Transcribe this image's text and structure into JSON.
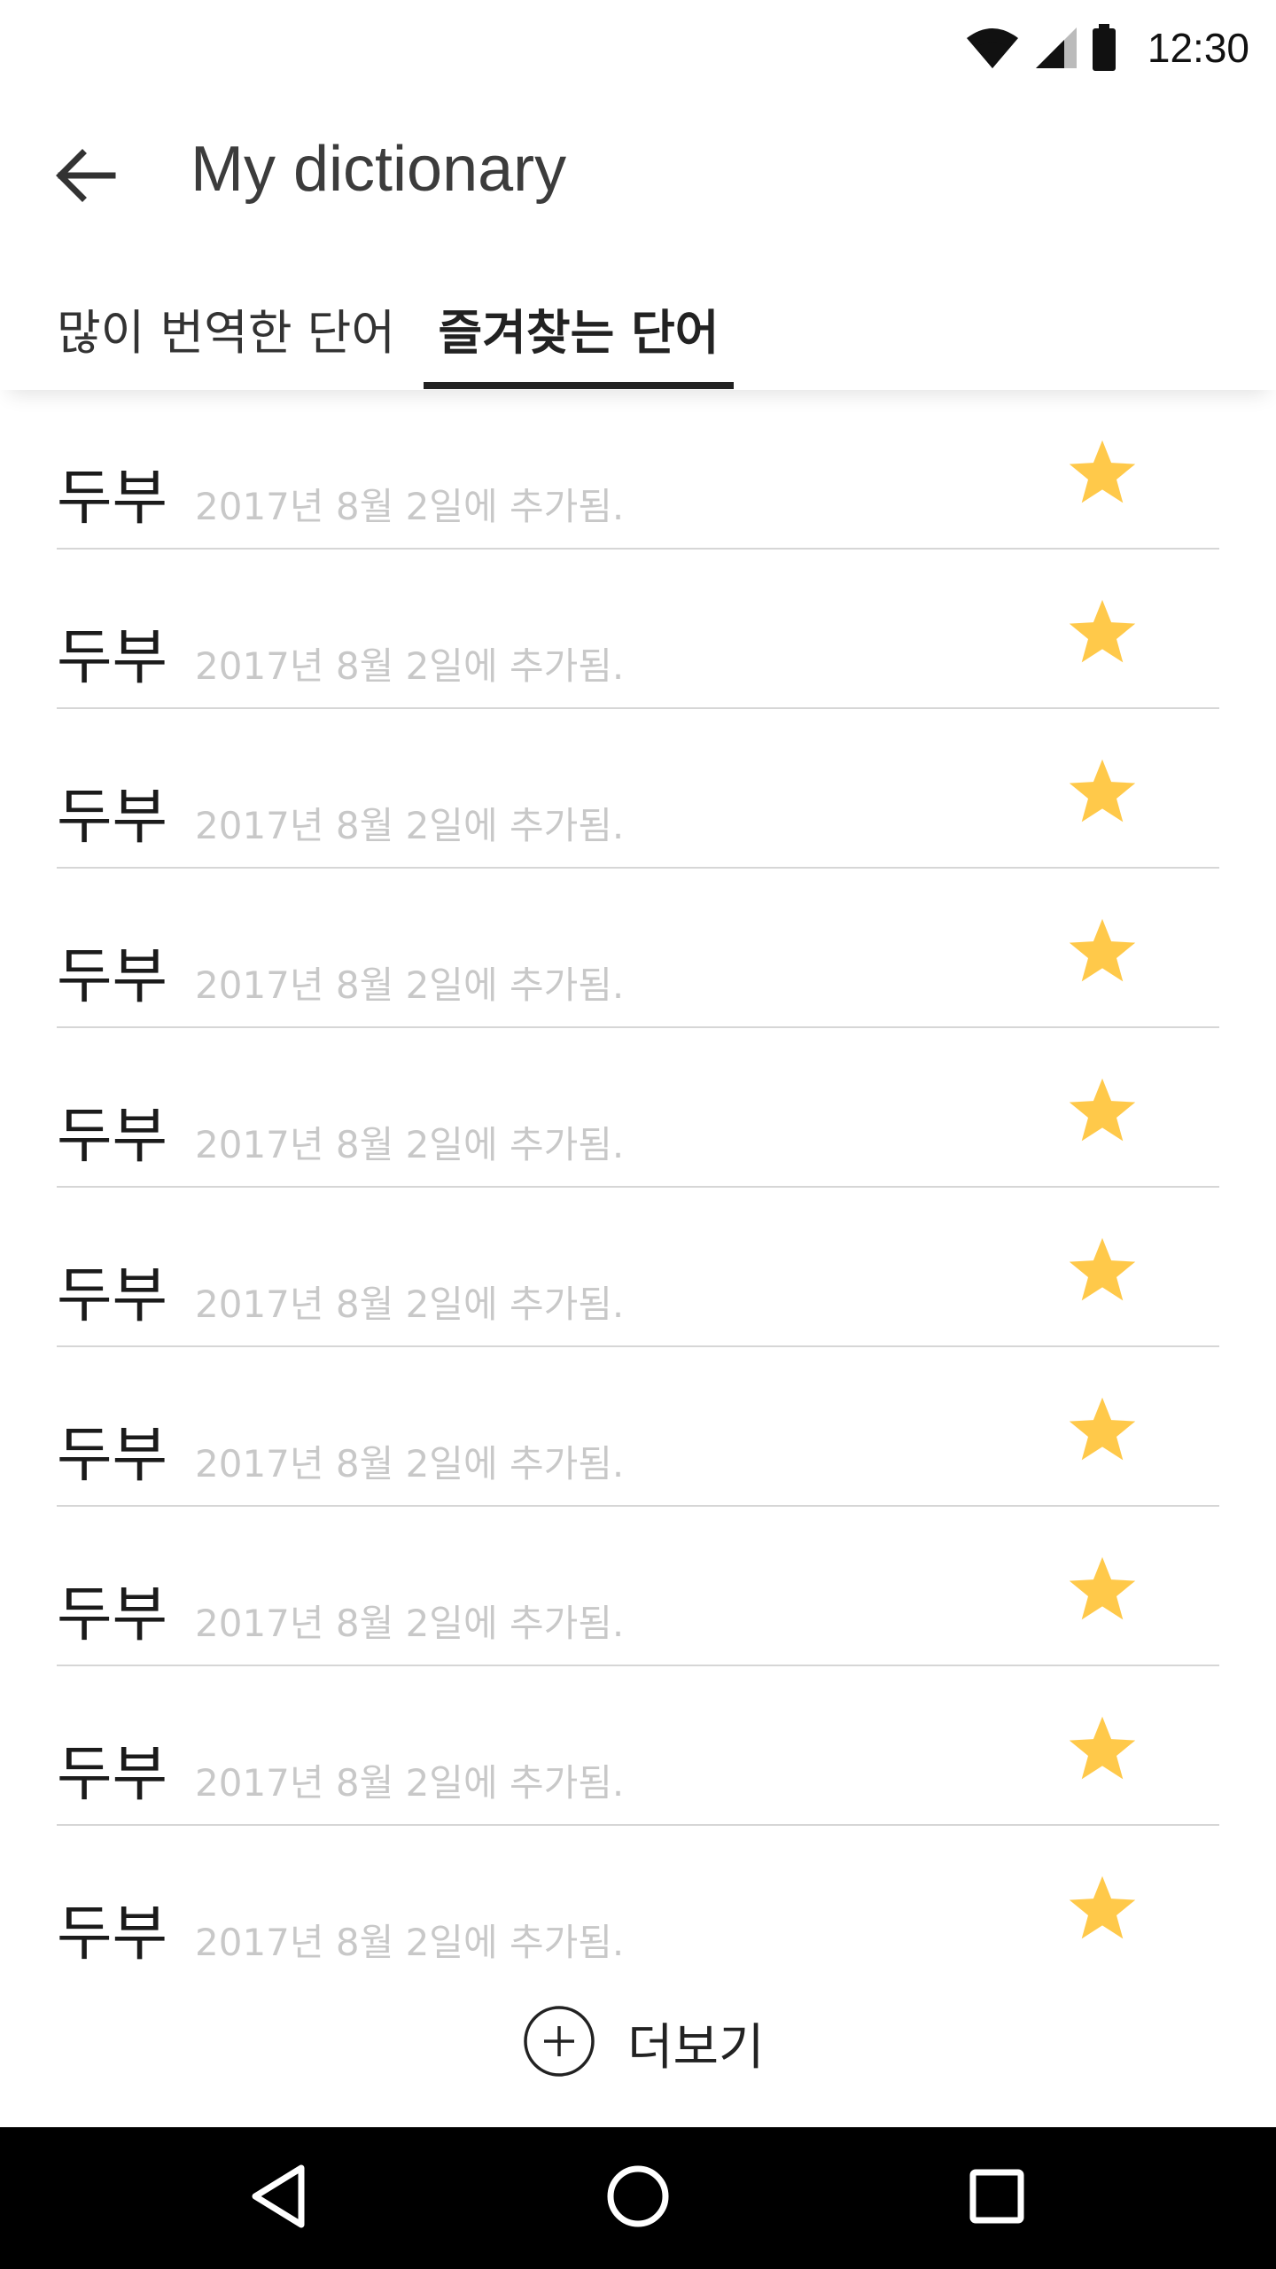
{
  "status_bar": {
    "time": "12:30",
    "icons": [
      "wifi-icon",
      "cell-signal-icon",
      "battery-icon"
    ]
  },
  "app_bar": {
    "back_icon": "arrow-left-icon",
    "title": "My dictionary"
  },
  "tabs": [
    {
      "label": "많이 번역한 단어",
      "selected": false
    },
    {
      "label": "즐겨찾는 단어",
      "selected": true
    }
  ],
  "words": [
    {
      "word": "두부",
      "date": "2017년 8월 2일에 추가됨.",
      "starred": true
    },
    {
      "word": "두부",
      "date": "2017년 8월 2일에 추가됨.",
      "starred": true
    },
    {
      "word": "두부",
      "date": "2017년 8월 2일에 추가됨.",
      "starred": true
    },
    {
      "word": "두부",
      "date": "2017년 8월 2일에 추가됨.",
      "starred": true
    },
    {
      "word": "두부",
      "date": "2017년 8월 2일에 추가됨.",
      "starred": true
    },
    {
      "word": "두부",
      "date": "2017년 8월 2일에 추가됨.",
      "starred": true
    },
    {
      "word": "두부",
      "date": "2017년 8월 2일에 추가됨.",
      "starred": true
    },
    {
      "word": "두부",
      "date": "2017년 8월 2일에 추가됨.",
      "starred": true
    },
    {
      "word": "두부",
      "date": "2017년 8월 2일에 추가됨.",
      "starred": true
    },
    {
      "word": "두부",
      "date": "2017년 8월 2일에 추가됨.",
      "starred": true
    }
  ],
  "more": {
    "icon": "plus-circle-icon",
    "label": "더보기"
  },
  "nav_bar": {
    "icons": [
      "nav-back-icon",
      "nav-home-icon",
      "nav-recents-icon"
    ]
  },
  "colors": {
    "star": "#FFC94A",
    "divider": "#D6D6D6",
    "date_text": "#C8C8C8",
    "nav_bar_bg": "#000000"
  }
}
